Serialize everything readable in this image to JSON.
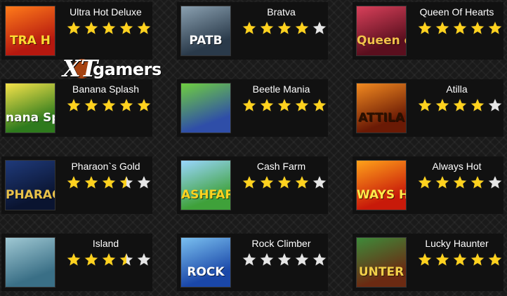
{
  "logo": {
    "text_a": "XT",
    "text_b": "gamers"
  },
  "games": [
    {
      "title": "Ultra Hot Deluxe",
      "rating": 5,
      "thumb_text": "TRA H",
      "thumb_bg": "#b5180f",
      "thumb_bg2": "#ff7b1a",
      "thumb_fg": "#ffdd33"
    },
    {
      "title": "Bratva",
      "rating": 4,
      "thumb_text": "PATB",
      "thumb_bg": "#2a3a4a",
      "thumb_bg2": "#8aa0b0",
      "thumb_fg": "#ffffff"
    },
    {
      "title": "Queen Of Hearts",
      "rating": 5,
      "thumb_text": "Queen of",
      "thumb_bg": "#5a0f1e",
      "thumb_bg2": "#d8405a",
      "thumb_fg": "#f2c24a"
    },
    {
      "title": "Banana Splash",
      "rating": 5,
      "thumb_text": "nana Spl",
      "thumb_bg": "#2e7a1d",
      "thumb_bg2": "#f6e34a",
      "thumb_fg": "#ffffff"
    },
    {
      "title": "Beetle Mania",
      "rating": 5,
      "thumb_text": "",
      "thumb_bg": "#2f4ea8",
      "thumb_bg2": "#6fcf3f",
      "thumb_fg": "#ffffff"
    },
    {
      "title": "Atilla",
      "rating": 4,
      "thumb_text": "ATTILA",
      "thumb_bg": "#6a1a05",
      "thumb_bg2": "#f28a20",
      "thumb_fg": "#2a1000"
    },
    {
      "title": "Pharaon`s Gold",
      "rating": 3.5,
      "thumb_text": "PHARAOHS",
      "thumb_bg": "#0a1430",
      "thumb_bg2": "#1f3a7a",
      "thumb_fg": "#e8c14a"
    },
    {
      "title": "Cash Farm",
      "rating": 4,
      "thumb_text": "ASHFARM",
      "thumb_bg": "#3fa13a",
      "thumb_bg2": "#9ad6ff",
      "thumb_fg": "#ffd21f"
    },
    {
      "title": "Always Hot",
      "rating": 4,
      "thumb_text": "WAYS H",
      "thumb_bg": "#c81a0a",
      "thumb_bg2": "#ffa21a",
      "thumb_fg": "#ffe94a"
    },
    {
      "title": "Island",
      "rating": 3.5,
      "thumb_text": "",
      "thumb_bg": "#3a6f86",
      "thumb_bg2": "#9fc8d3",
      "thumb_fg": "#ffffff"
    },
    {
      "title": "Rock Climber",
      "rating": 0,
      "thumb_text": "ROCK",
      "thumb_bg": "#1a47a8",
      "thumb_bg2": "#7ac0f0",
      "thumb_fg": "#ffffff"
    },
    {
      "title": "Lucky Haunter",
      "rating": 5,
      "thumb_text": "UNTER",
      "thumb_bg": "#6b2a12",
      "thumb_bg2": "#3e8a3a",
      "thumb_fg": "#f2d04a"
    }
  ],
  "colors": {
    "star_on": "#ffd21f",
    "star_off": "#e6e6e6",
    "card": "#111111",
    "title": "#ffffff"
  },
  "icons": {
    "star": "star-icon"
  }
}
